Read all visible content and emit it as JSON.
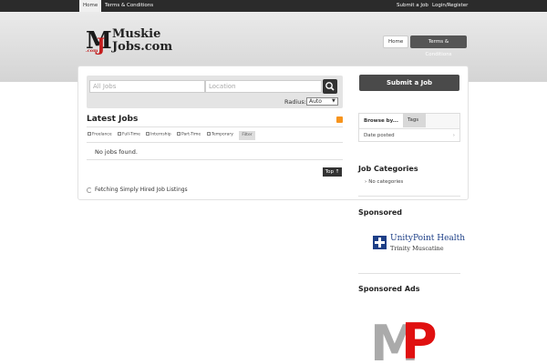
{
  "topbar": {
    "home": "Home",
    "terms": "Terms & Conditions",
    "submit": "Submit a Job",
    "login": "Login/Register"
  },
  "header": {
    "logo_mark": "M",
    "logo_j": "J",
    "logo_com": ".com",
    "logo_line1": "Muskie",
    "logo_line2": "Jobs.com",
    "nav_home": "Home",
    "nav_terms": "Terms & Conditions"
  },
  "search": {
    "jobs_placeholder": "All Jobs",
    "location_placeholder": "Location",
    "radius_label": "Radius:",
    "radius_value": "Auto"
  },
  "latest": {
    "title": "Latest Jobs",
    "filters": [
      "Freelance",
      "Full-Time",
      "Internship",
      "Part-Time",
      "Temporary"
    ],
    "filter_button": "Filter",
    "empty": "No jobs found.",
    "top_button": "Top ↑",
    "fetching": "Fetching Simply Hired Job Listings"
  },
  "sidebar": {
    "submit_button": "Submit a Job",
    "browse_tab": "Browse by...",
    "tags_tab": "Tags",
    "date_posted": "Date posted",
    "categories_title": "Job Categories",
    "no_categories": "No categories",
    "sponsored_title": "Sponsored",
    "sponsor_name": "UnityPoint Health",
    "sponsor_sub": "Trinity Muscatine",
    "sponsored_ads_title": "Sponsored Ads",
    "ad_m": "M",
    "ad_p": "P"
  }
}
